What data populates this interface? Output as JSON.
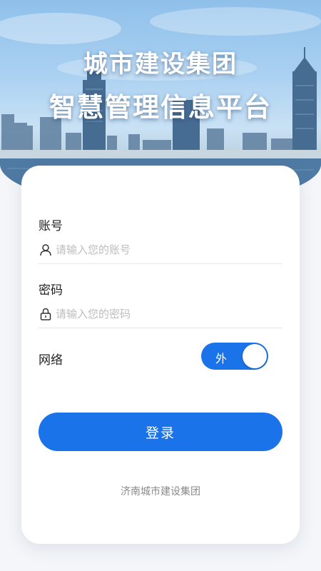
{
  "hero": {
    "title_line1": "城市建设集团",
    "title_line2": "智慧管理信息平台"
  },
  "form": {
    "account": {
      "label": "账号",
      "placeholder": "请输入您的账号",
      "value": "",
      "icon": "user-icon"
    },
    "password": {
      "label": "密码",
      "placeholder": "请输入您的密码",
      "value": "",
      "icon": "lock-icon"
    },
    "network": {
      "label": "网络",
      "toggle_text": "外",
      "state": "on"
    },
    "login_button": "登录"
  },
  "footer": {
    "org_name": "济南城市建设集团"
  },
  "colors": {
    "accent": "#1a73e8",
    "card_bg": "#ffffff",
    "placeholder": "#bdbdbd"
  }
}
